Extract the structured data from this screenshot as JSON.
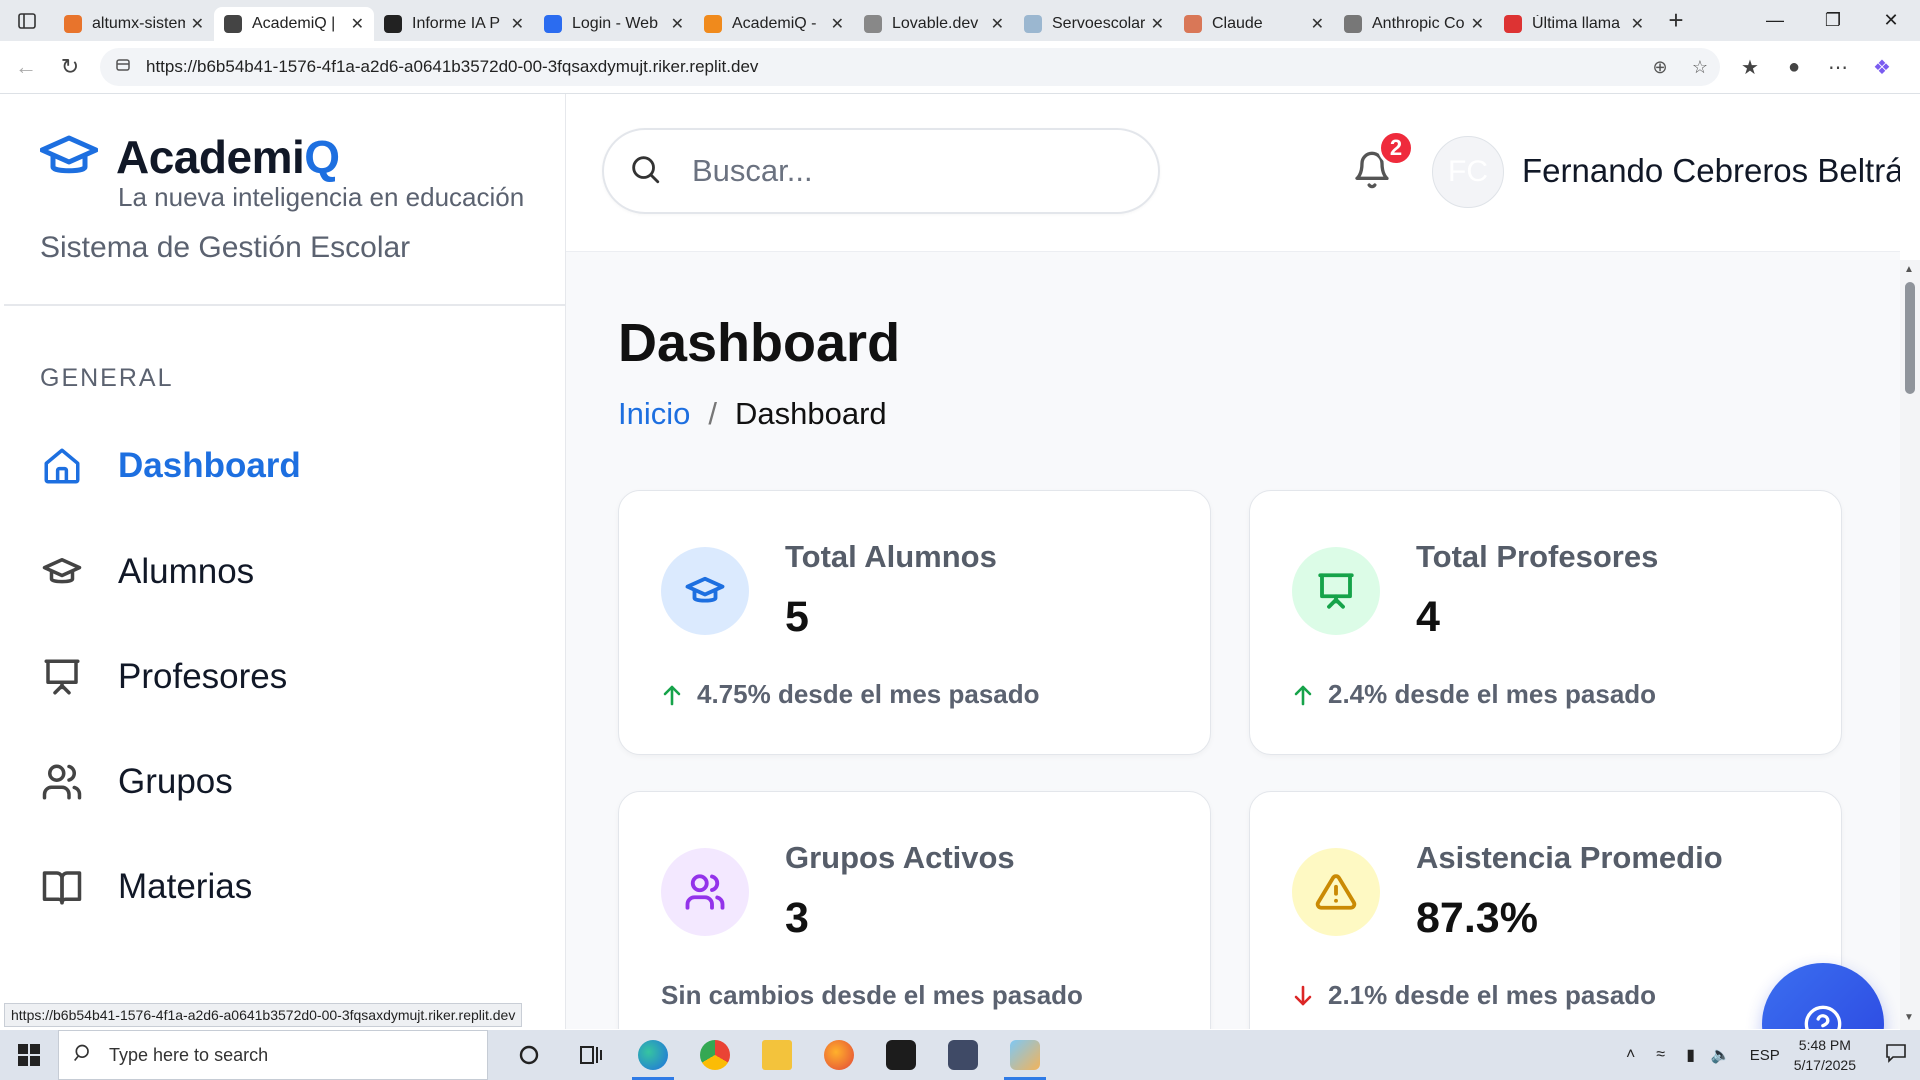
{
  "browser": {
    "tabs": [
      {
        "title": "altumx-sistema",
        "color": "#e8742c"
      },
      {
        "title": "AcademiQ | ",
        "color": "#444",
        "active": true
      },
      {
        "title": "Informe IA P",
        "color": "#222"
      },
      {
        "title": "Login - Web",
        "color": "#2b6cf0"
      },
      {
        "title": "AcademiQ - ",
        "color": "#f08a1c"
      },
      {
        "title": "Lovable.dev",
        "color": "#888"
      },
      {
        "title": "Servoescolar",
        "color": "#9bb7d0"
      },
      {
        "title": "Claude",
        "color": "#d97757"
      },
      {
        "title": "Anthropic Co",
        "color": "#777"
      },
      {
        "title": "Última llama",
        "color": "#d33"
      }
    ],
    "url": "https://b6b54b41-1576-4f1a-a2d6-a0641b3572d0-00-3fqsaxdymujt.riker.replit.dev",
    "status_url": "https://b6b54b41-1576-4f1a-a2d6-a0641b3572d0-00-3fqsaxdymujt.riker.replit.dev"
  },
  "sidebar": {
    "brand_prefix": "Academi",
    "brand_suffix": "Q",
    "tagline": "La nueva inteligencia en educación",
    "subtitle": "Sistema de Gestión Escolar",
    "section_label": "GENERAL",
    "items": [
      {
        "label": "Dashboard",
        "icon": "home-icon",
        "active": true
      },
      {
        "label": "Alumnos",
        "icon": "graduation-cap-icon"
      },
      {
        "label": "Profesores",
        "icon": "presentation-icon"
      },
      {
        "label": "Grupos",
        "icon": "users-icon"
      },
      {
        "label": "Materias",
        "icon": "book-icon"
      }
    ]
  },
  "header": {
    "search_placeholder": "Buscar...",
    "notification_count": "2",
    "avatar_initials": "FC",
    "user_name": "Fernando Cebreros Beltrán"
  },
  "main": {
    "title": "Dashboard",
    "breadcrumb": {
      "home": "Inicio",
      "separator": "/",
      "current": "Dashboard"
    },
    "cards": [
      {
        "label": "Total Alumnos",
        "value": "5",
        "trend": "4.75% desde el mes pasado",
        "trend_dir": "up",
        "icon": "graduation-cap-icon",
        "icon_bg": "#dbeafe",
        "icon_color": "#1d6fe0"
      },
      {
        "label": "Total Profesores",
        "value": "4",
        "trend": "2.4% desde el mes pasado",
        "trend_dir": "up",
        "icon": "presentation-icon",
        "icon_bg": "#dcfce7",
        "icon_color": "#16a34a"
      },
      {
        "label": "Grupos Activos",
        "value": "3",
        "trend": "Sin cambios desde el mes pasado",
        "trend_dir": "none",
        "icon": "users-icon",
        "icon_bg": "#f3e8ff",
        "icon_color": "#9333ea"
      },
      {
        "label": "Asistencia Promedio",
        "value": "87.3%",
        "trend": "2.1% desde el mes pasado",
        "trend_dir": "down",
        "icon": "alert-triangle-icon",
        "icon_bg": "#fef9c3",
        "icon_color": "#ca8a04"
      }
    ]
  },
  "taskbar": {
    "search_placeholder": "Type here to search",
    "language": "ESP",
    "time": "5:48 PM",
    "date": "5/17/2025"
  },
  "colors": {
    "accent": "#1d6fe0",
    "up": "#16a34a",
    "down": "#dc2626",
    "badge": "#ef2b3c"
  }
}
